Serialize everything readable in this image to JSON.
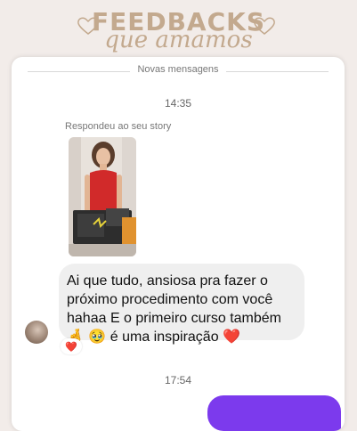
{
  "banner": {
    "title_line1": "FEEDBACKS",
    "title_line2": "que amamos",
    "decoration_icons": [
      "heart-outline-icon",
      "heart-outline-icon"
    ],
    "accent_color": "#c3a98e"
  },
  "chat": {
    "divider_label": "Novas mensagens",
    "time_1": "14:35",
    "reply_context": "Respondeu ao seu story",
    "message": {
      "text_before_emoji": "Ai que tudo, ansiosa pra fazer o próximo procedimento com você hahaa E o primeiro curso também ",
      "emoji_1": "🤞",
      "emoji_2": "🥹",
      "text_after_emoji": " é uma inspiração ",
      "emoji_3": "❤️"
    },
    "reaction": "❤️",
    "time_2": "17:54",
    "outgoing_message_partial": "",
    "outgoing_color": "#7c3aed"
  }
}
